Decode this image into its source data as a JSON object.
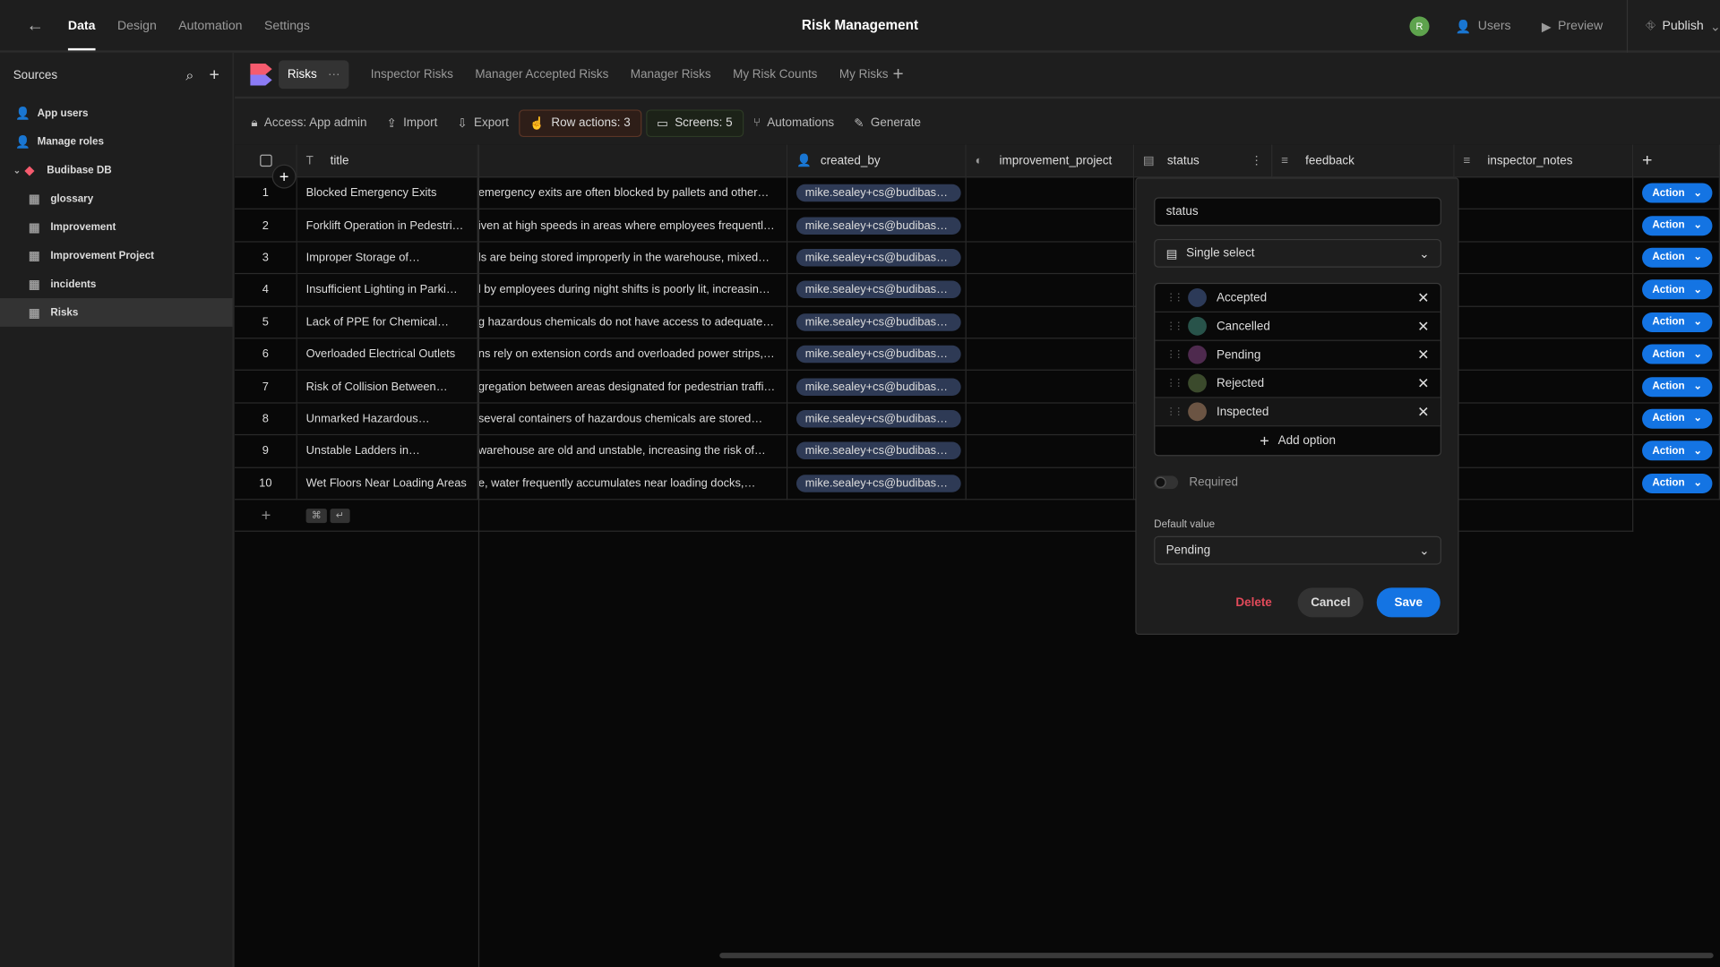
{
  "app": {
    "title": "Risk Management",
    "avatar": "R"
  },
  "topnav": {
    "items": [
      "Data",
      "Design",
      "Automation",
      "Settings"
    ],
    "active": "Data",
    "users": "Users",
    "preview": "Preview",
    "publish": "Publish"
  },
  "sidebar": {
    "title": "Sources",
    "items": [
      {
        "label": "App users",
        "icon": "user-icon"
      },
      {
        "label": "Manage roles",
        "icon": "roles-icon"
      },
      {
        "label": "Budibase DB",
        "icon": "budibase-icon"
      },
      {
        "label": "glossary",
        "icon": "table-icon"
      },
      {
        "label": "Improvement",
        "icon": "table-icon"
      },
      {
        "label": "Improvement Project",
        "icon": "table-icon"
      },
      {
        "label": "incidents",
        "icon": "table-icon"
      },
      {
        "label": "Risks",
        "icon": "table-icon",
        "selected": true
      }
    ]
  },
  "tabs": {
    "items": [
      "Risks",
      "Inspector Risks",
      "Manager Accepted Risks",
      "Manager Risks",
      "My Risk Counts",
      "My Risks"
    ],
    "more": "···"
  },
  "toolbar": {
    "access": "Access: App admin",
    "import": "Import",
    "export": "Export",
    "row_actions": "Row actions: 3",
    "screens": "Screens: 5",
    "automations": "Automations",
    "generate": "Generate"
  },
  "grid": {
    "columns": [
      "title",
      "",
      "created_by",
      "improvement_project",
      "status",
      "feedback",
      "inspector_notes"
    ],
    "rows": [
      {
        "n": "1",
        "title": "Blocked Emergency Exits",
        "desc": "emergency exits are often blocked by pallets and other…",
        "by": "mike.sealey+cs@budibas…"
      },
      {
        "n": "2",
        "title": "Forklift Operation in Pedestri…",
        "desc": "iven at high speeds in areas where employees frequentl…",
        "by": "mike.sealey+cs@budibas…"
      },
      {
        "n": "3",
        "title": "Improper Storage of…",
        "desc": "ls are being stored improperly in the warehouse, mixed…",
        "by": "mike.sealey+cs@budibas…"
      },
      {
        "n": "4",
        "title": "Insufficient Lighting in Parki…",
        "desc": "l by employees during night shifts is poorly lit, increasin…",
        "by": "mike.sealey+cs@budibas…"
      },
      {
        "n": "5",
        "title": "Lack of PPE for Chemical…",
        "desc": "g hazardous chemicals do not have access to adequate…",
        "by": "mike.sealey+cs@budibas…"
      },
      {
        "n": "6",
        "title": "Overloaded Electrical Outlets",
        "desc": "ns rely on extension cords and overloaded power strips,…",
        "by": "mike.sealey+cs@budibas…"
      },
      {
        "n": "7",
        "title": "Risk of Collision Between…",
        "desc": "gregation between areas designated for pedestrian traffi…",
        "by": "mike.sealey+cs@budibas…"
      },
      {
        "n": "8",
        "title": "Unmarked Hazardous…",
        "desc": "several containers of hazardous chemicals are stored…",
        "by": "mike.sealey+cs@budibas…"
      },
      {
        "n": "9",
        "title": "Unstable Ladders in…",
        "desc": "warehouse are old and unstable, increasing the risk of…",
        "by": "mike.sealey+cs@budibas…"
      },
      {
        "n": "10",
        "title": "Wet Floors Near Loading Areas",
        "desc": "e, water frequently accumulates near loading docks,…",
        "by": "mike.sealey+cs@budibas…"
      }
    ],
    "action_label": "Action",
    "kbd": [
      "⌘",
      "↵"
    ]
  },
  "popover": {
    "name": "status",
    "type": "Single select",
    "options": [
      {
        "label": "Accepted",
        "color": "#2c3a58"
      },
      {
        "label": "Cancelled",
        "color": "#28534a"
      },
      {
        "label": "Pending",
        "color": "#4e2a4e"
      },
      {
        "label": "Rejected",
        "color": "#3b4a2c"
      },
      {
        "label": "Inspected",
        "color": "#6b5443"
      }
    ],
    "add_option": "Add option",
    "required": "Required",
    "required_on": false,
    "default_label": "Default value",
    "default_value": "Pending",
    "delete": "Delete",
    "cancel": "Cancel",
    "save": "Save"
  }
}
